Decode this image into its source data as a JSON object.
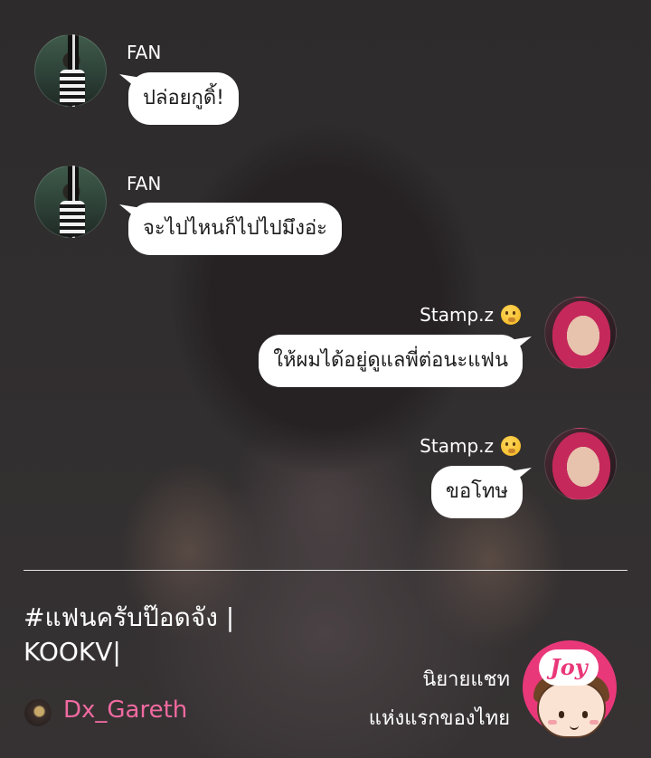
{
  "messages": [
    {
      "sender": "FAN",
      "side": "left",
      "text": "ปล่อยกูดิ้!"
    },
    {
      "sender": "FAN",
      "side": "left",
      "text": "จะไปไหนก็ไปไปมึงอ่ะ"
    },
    {
      "sender": "Stamp.z",
      "side": "right",
      "text": "ให้ผมได้อยู่ดูแลพี่ต่อนะแฟน",
      "sender_emoji": "shushing-face"
    },
    {
      "sender": "Stamp.z",
      "side": "right",
      "text": "ขอโทษ",
      "sender_emoji": "shushing-face"
    }
  ],
  "story": {
    "title": "#แฟนครับป๊อดจัง | KOOKV|",
    "author": "Dx_Gareth"
  },
  "brand": {
    "logo_text": "Joy",
    "tagline_line1": "นิยายแชท",
    "tagline_line2": "แห่งแรกของไทย"
  },
  "colors": {
    "background": "#2e2c2d",
    "bubble": "#ffffff",
    "author": "#f06aa0",
    "brand": "#e9387a"
  }
}
